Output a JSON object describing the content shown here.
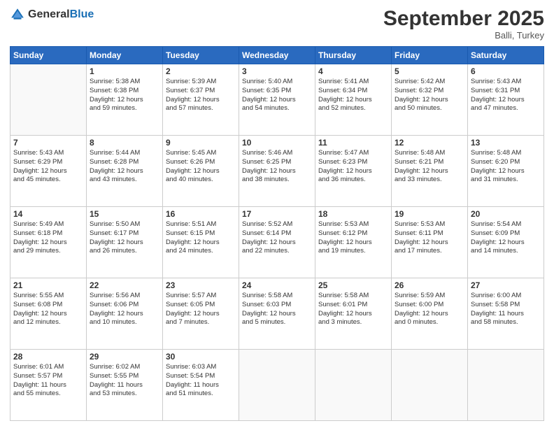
{
  "header": {
    "logo_general": "General",
    "logo_blue": "Blue",
    "month": "September 2025",
    "location": "Balli, Turkey"
  },
  "weekdays": [
    "Sunday",
    "Monday",
    "Tuesday",
    "Wednesday",
    "Thursday",
    "Friday",
    "Saturday"
  ],
  "weeks": [
    [
      {
        "day": "",
        "sunrise": "",
        "sunset": "",
        "daylight": ""
      },
      {
        "day": "1",
        "sunrise": "5:38 AM",
        "sunset": "6:38 PM",
        "daylight": "12 hours and 59 minutes."
      },
      {
        "day": "2",
        "sunrise": "5:39 AM",
        "sunset": "6:37 PM",
        "daylight": "12 hours and 57 minutes."
      },
      {
        "day": "3",
        "sunrise": "5:40 AM",
        "sunset": "6:35 PM",
        "daylight": "12 hours and 54 minutes."
      },
      {
        "day": "4",
        "sunrise": "5:41 AM",
        "sunset": "6:34 PM",
        "daylight": "12 hours and 52 minutes."
      },
      {
        "day": "5",
        "sunrise": "5:42 AM",
        "sunset": "6:32 PM",
        "daylight": "12 hours and 50 minutes."
      },
      {
        "day": "6",
        "sunrise": "5:43 AM",
        "sunset": "6:31 PM",
        "daylight": "12 hours and 47 minutes."
      }
    ],
    [
      {
        "day": "7",
        "sunrise": "5:43 AM",
        "sunset": "6:29 PM",
        "daylight": "12 hours and 45 minutes."
      },
      {
        "day": "8",
        "sunrise": "5:44 AM",
        "sunset": "6:28 PM",
        "daylight": "12 hours and 43 minutes."
      },
      {
        "day": "9",
        "sunrise": "5:45 AM",
        "sunset": "6:26 PM",
        "daylight": "12 hours and 40 minutes."
      },
      {
        "day": "10",
        "sunrise": "5:46 AM",
        "sunset": "6:25 PM",
        "daylight": "12 hours and 38 minutes."
      },
      {
        "day": "11",
        "sunrise": "5:47 AM",
        "sunset": "6:23 PM",
        "daylight": "12 hours and 36 minutes."
      },
      {
        "day": "12",
        "sunrise": "5:48 AM",
        "sunset": "6:21 PM",
        "daylight": "12 hours and 33 minutes."
      },
      {
        "day": "13",
        "sunrise": "5:48 AM",
        "sunset": "6:20 PM",
        "daylight": "12 hours and 31 minutes."
      }
    ],
    [
      {
        "day": "14",
        "sunrise": "5:49 AM",
        "sunset": "6:18 PM",
        "daylight": "12 hours and 29 minutes."
      },
      {
        "day": "15",
        "sunrise": "5:50 AM",
        "sunset": "6:17 PM",
        "daylight": "12 hours and 26 minutes."
      },
      {
        "day": "16",
        "sunrise": "5:51 AM",
        "sunset": "6:15 PM",
        "daylight": "12 hours and 24 minutes."
      },
      {
        "day": "17",
        "sunrise": "5:52 AM",
        "sunset": "6:14 PM",
        "daylight": "12 hours and 22 minutes."
      },
      {
        "day": "18",
        "sunrise": "5:53 AM",
        "sunset": "6:12 PM",
        "daylight": "12 hours and 19 minutes."
      },
      {
        "day": "19",
        "sunrise": "5:53 AM",
        "sunset": "6:11 PM",
        "daylight": "12 hours and 17 minutes."
      },
      {
        "day": "20",
        "sunrise": "5:54 AM",
        "sunset": "6:09 PM",
        "daylight": "12 hours and 14 minutes."
      }
    ],
    [
      {
        "day": "21",
        "sunrise": "5:55 AM",
        "sunset": "6:08 PM",
        "daylight": "12 hours and 12 minutes."
      },
      {
        "day": "22",
        "sunrise": "5:56 AM",
        "sunset": "6:06 PM",
        "daylight": "12 hours and 10 minutes."
      },
      {
        "day": "23",
        "sunrise": "5:57 AM",
        "sunset": "6:05 PM",
        "daylight": "12 hours and 7 minutes."
      },
      {
        "day": "24",
        "sunrise": "5:58 AM",
        "sunset": "6:03 PM",
        "daylight": "12 hours and 5 minutes."
      },
      {
        "day": "25",
        "sunrise": "5:58 AM",
        "sunset": "6:01 PM",
        "daylight": "12 hours and 3 minutes."
      },
      {
        "day": "26",
        "sunrise": "5:59 AM",
        "sunset": "6:00 PM",
        "daylight": "12 hours and 0 minutes."
      },
      {
        "day": "27",
        "sunrise": "6:00 AM",
        "sunset": "5:58 PM",
        "daylight": "11 hours and 58 minutes."
      }
    ],
    [
      {
        "day": "28",
        "sunrise": "6:01 AM",
        "sunset": "5:57 PM",
        "daylight": "11 hours and 55 minutes."
      },
      {
        "day": "29",
        "sunrise": "6:02 AM",
        "sunset": "5:55 PM",
        "daylight": "11 hours and 53 minutes."
      },
      {
        "day": "30",
        "sunrise": "6:03 AM",
        "sunset": "5:54 PM",
        "daylight": "11 hours and 51 minutes."
      },
      {
        "day": "",
        "sunrise": "",
        "sunset": "",
        "daylight": ""
      },
      {
        "day": "",
        "sunrise": "",
        "sunset": "",
        "daylight": ""
      },
      {
        "day": "",
        "sunrise": "",
        "sunset": "",
        "daylight": ""
      },
      {
        "day": "",
        "sunrise": "",
        "sunset": "",
        "daylight": ""
      }
    ]
  ],
  "labels": {
    "sunrise": "Sunrise:",
    "sunset": "Sunset:",
    "daylight": "Daylight:"
  }
}
